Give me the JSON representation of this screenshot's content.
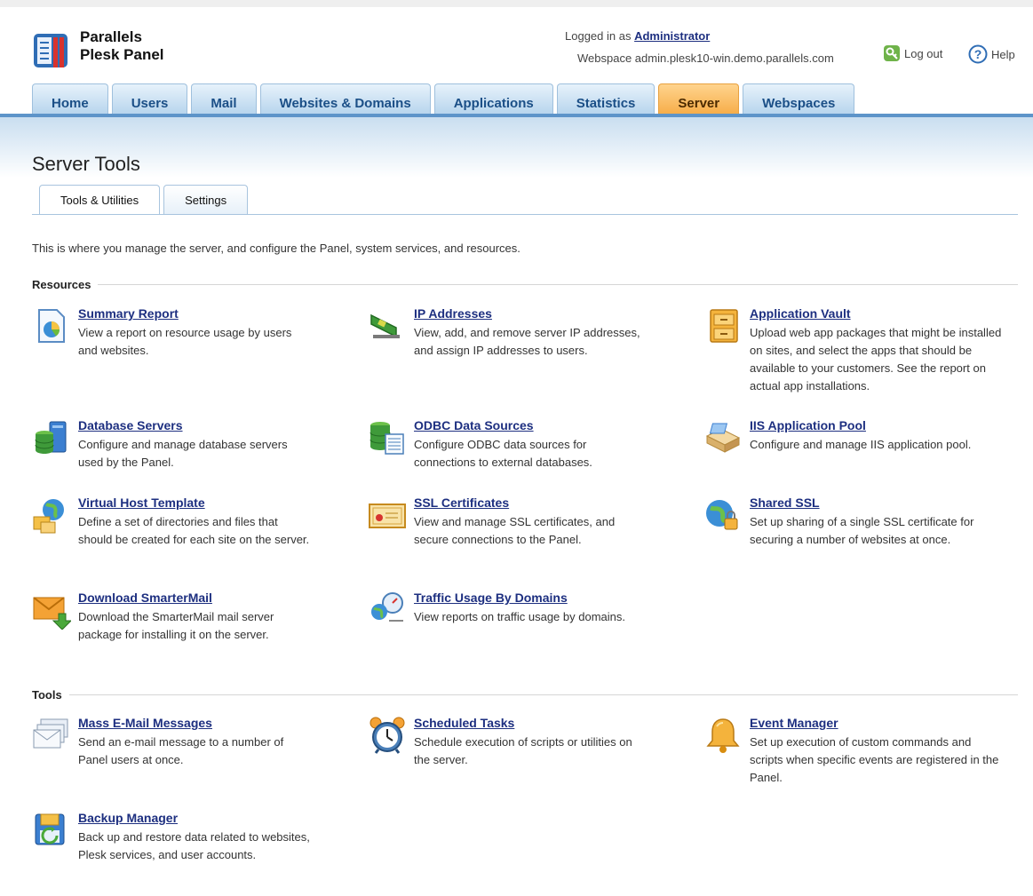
{
  "brand": {
    "line1": "Parallels",
    "line2": "Plesk Panel"
  },
  "header": {
    "logged_prefix": "Logged in as",
    "user": "Administrator",
    "webspace": "Webspace admin.plesk10-win.demo.parallels.com",
    "logout_label": "Log out",
    "help_label": "Help"
  },
  "nav": {
    "tabs": [
      "Home",
      "Users",
      "Mail",
      "Websites & Domains",
      "Applications",
      "Statistics",
      "Server",
      "Webspaces"
    ],
    "active": "Server"
  },
  "page": {
    "title": "Server Tools",
    "subtabs": [
      "Tools & Utilities",
      "Settings"
    ],
    "intro": "This is where you manage the server, and configure the Panel, system services, and resources."
  },
  "resources": {
    "heading": "Resources",
    "items": [
      {
        "title": "Summary Report",
        "desc": "View a report on resource usage by users and websites.",
        "icon": "summary-report-icon"
      },
      {
        "title": "IP Addresses",
        "desc": "View, add, and remove server IP addresses, and assign IP addresses to users.",
        "icon": "network-card-icon"
      },
      {
        "title": "Application Vault",
        "desc": "Upload web app packages that might be installed on sites, and select the apps that should be available to your customers. See the report on actual app installations.",
        "icon": "vault-icon"
      },
      {
        "title": "Database Servers",
        "desc": "Configure and manage database servers used by the Panel.",
        "icon": "database-server-icon"
      },
      {
        "title": "ODBC Data Sources",
        "desc": "Configure ODBC data sources for connections to external databases.",
        "icon": "odbc-icon"
      },
      {
        "title": "IIS Application Pool",
        "desc": "Configure and manage IIS application pool.",
        "icon": "app-pool-icon"
      },
      {
        "title": "Virtual Host Template",
        "desc": "Define a set of directories and files that should be created for each site on the server.",
        "icon": "host-template-icon"
      },
      {
        "title": "SSL Certificates",
        "desc": "View and manage SSL certificates, and secure connections to the Panel.",
        "icon": "certificate-icon"
      },
      {
        "title": "Shared SSL",
        "desc": "Set up sharing of a single SSL certificate for securing a number of websites at once.",
        "icon": "shared-ssl-icon"
      },
      {
        "title": "Download SmarterMail",
        "desc": "Download the SmarterMail mail server package for installing it on the server.",
        "icon": "download-mail-icon"
      },
      {
        "title": "Traffic Usage By Domains",
        "desc": "View reports on traffic usage by domains.",
        "icon": "traffic-icon"
      }
    ]
  },
  "tools": {
    "heading": "Tools",
    "items": [
      {
        "title": "Mass E-Mail Messages",
        "desc": "Send an e-mail message to a number of Panel users at once.",
        "icon": "mass-mail-icon"
      },
      {
        "title": "Scheduled Tasks",
        "desc": "Schedule execution of scripts or utilities on the server.",
        "icon": "alarm-clock-icon"
      },
      {
        "title": "Event Manager",
        "desc": "Set up execution of custom commands and scripts when specific events are registered in the Panel.",
        "icon": "bell-icon"
      },
      {
        "title": "Backup Manager",
        "desc": "Back up and restore data related to websites, Plesk services, and user accounts.",
        "icon": "backup-icon"
      }
    ]
  },
  "colors": {
    "link": "#1d2f80",
    "tab_blue": "#a9cce9",
    "tab_active": "#f4a235",
    "bar": "#5d94c9"
  }
}
